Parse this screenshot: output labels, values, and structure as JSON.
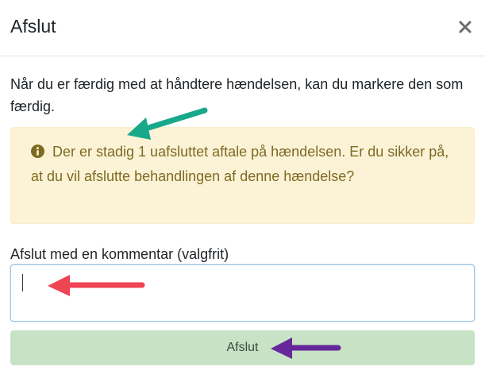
{
  "modal": {
    "title": "Afslut",
    "close_icon": "close-icon",
    "intro_text": "Når du er færdig med at håndtere hændelsen, kan du markere den som færdig.",
    "alert": {
      "icon": "info-circle-icon",
      "text": "Der er stadig 1 uafsluttet aftale på hændelsen. Er du sikker på, at du vil afslutte behandlingen af denne hændelse?",
      "background_color": "#fcf3d6",
      "text_color": "#7d6a23"
    },
    "comment": {
      "label": "Afslut med en kommentar (valgfrit)",
      "value": "",
      "placeholder": ""
    },
    "submit_label": "Afslut",
    "submit_color": "#c8e2c6"
  },
  "annotations": {
    "arrow_colors": [
      "#18a88a",
      "#ef4452",
      "#66279a"
    ]
  }
}
